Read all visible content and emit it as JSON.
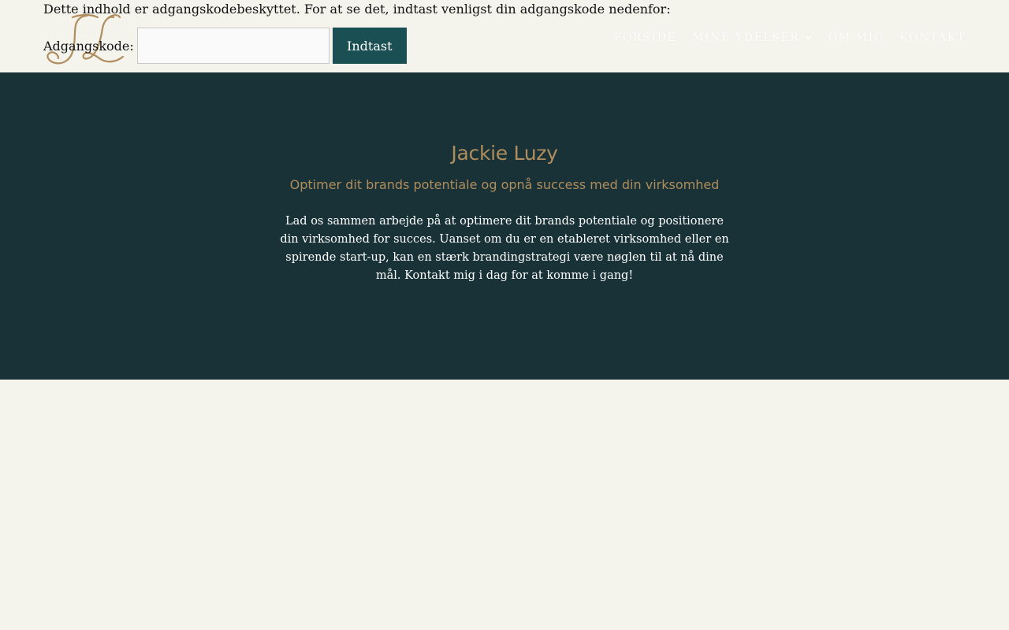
{
  "protected": {
    "notice": "Dette indhold er adgangskodebeskyttet. For at se det, indtast venligst din adgangskode nedenfor:",
    "label": "Adgangskode:",
    "input_value": "",
    "submit_label": "Indtast"
  },
  "header": {
    "logo_icon": "jl-monogram-logo",
    "nav": [
      {
        "label": "FORSIDE"
      },
      {
        "label": "MINE YDELSER",
        "has_dropdown": true
      },
      {
        "label": "OM MIG"
      },
      {
        "label": "KONTAKT"
      }
    ]
  },
  "hero": {
    "title": "Jackie Luzy",
    "subtitle": "Optimer dit brands potentiale og opnå success med din virksomhed",
    "body": "Lad os sammen arbejde på at optimere dit brands potentiale og positionere din virksomhed for succes. Uanset om du er en etableret virksomhed eller en spirende start-up, kan en stærk brandingstrategi være nøglen til at nå dine mål. Kontakt mig i dag for at komme i gang!"
  },
  "colors": {
    "accent_gold": "#b08d5c",
    "hero_bg": "#193237",
    "button_bg": "#1a4f53",
    "page_bg": "#f4f3ec"
  }
}
